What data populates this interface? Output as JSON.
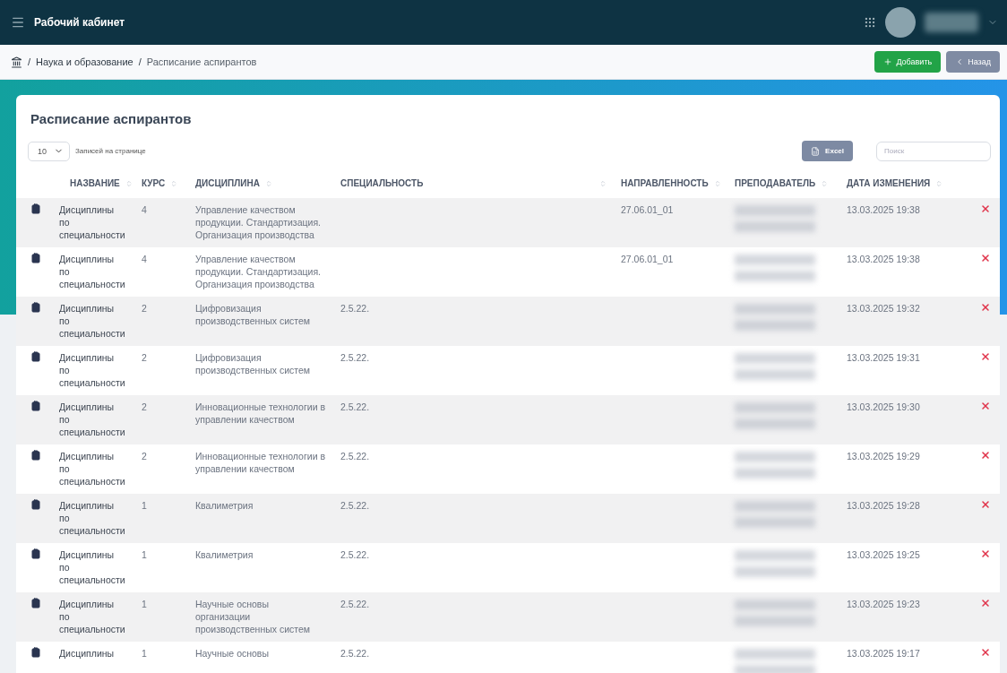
{
  "topbar": {
    "title": "Рабочий кабинет"
  },
  "breadcrumb": [
    {
      "separator": "/",
      "label": "Наука и образование"
    },
    {
      "separator": "/",
      "label": "Расписание аспирантов"
    }
  ],
  "actions": [
    {
      "kind": "add",
      "label": "Добавить"
    },
    {
      "kind": "back",
      "label": "Назад"
    }
  ],
  "card": {
    "title": "Расписание аспирантов",
    "page_size": "10",
    "page_size_label": "Записей на странице",
    "export_label": "Excel",
    "search": {
      "placeholder": "Поиск"
    }
  },
  "table": {
    "columns": [
      "НАЗВАНИЕ",
      "КУРС",
      "ДИСЦИПЛИНА",
      "СПЕЦИАЛЬНОСТЬ",
      "НАПРАВЛЕННОСТЬ",
      "ПРЕПОДАВАТЕЛЬ",
      "ДАТА ИЗМЕНЕНИЯ"
    ],
    "rows": [
      {
        "name": "Дисциплины по специальности",
        "course": "4",
        "discipline": "Управление качеством продукции. Стандартизация. Организация производства",
        "specialty": "",
        "direction": "27.06.01_01",
        "date": "13.03.2025 19:38"
      },
      {
        "name": "Дисциплины по специальности",
        "course": "4",
        "discipline": "Управление качеством продукции. Стандартизация. Организация производства",
        "specialty": "",
        "direction": "27.06.01_01",
        "date": "13.03.2025 19:38"
      },
      {
        "name": "Дисциплины по специальности",
        "course": "2",
        "discipline": "Цифровизация производственных систем",
        "specialty": "2.5.22.",
        "direction": "",
        "date": "13.03.2025 19:32"
      },
      {
        "name": "Дисциплины по специальности",
        "course": "2",
        "discipline": "Цифровизация производственных систем",
        "specialty": "2.5.22.",
        "direction": "",
        "date": "13.03.2025 19:31"
      },
      {
        "name": "Дисциплины по специальности",
        "course": "2",
        "discipline": "Инновационные технологии в управлении качеством",
        "specialty": "2.5.22.",
        "direction": "",
        "date": "13.03.2025 19:30"
      },
      {
        "name": "Дисциплины по специальности",
        "course": "2",
        "discipline": "Инновационные технологии в управлении качеством",
        "specialty": "2.5.22.",
        "direction": "",
        "date": "13.03.2025 19:29"
      },
      {
        "name": "Дисциплины по специальности",
        "course": "1",
        "discipline": "Квалиметрия",
        "specialty": "2.5.22.",
        "direction": "",
        "date": "13.03.2025 19:28"
      },
      {
        "name": "Дисциплины по специальности",
        "course": "1",
        "discipline": "Квалиметрия",
        "specialty": "2.5.22.",
        "direction": "",
        "date": "13.03.2025 19:25"
      },
      {
        "name": "Дисциплины по специальности",
        "course": "1",
        "discipline": "Научные основы организации производственных систем",
        "specialty": "2.5.22.",
        "direction": "",
        "date": "13.03.2025 19:23"
      },
      {
        "name": "Дисциплины",
        "course": "1",
        "discipline": "Научные основы",
        "specialty": "2.5.22.",
        "direction": "",
        "date": "13.03.2025 19:17"
      }
    ]
  }
}
